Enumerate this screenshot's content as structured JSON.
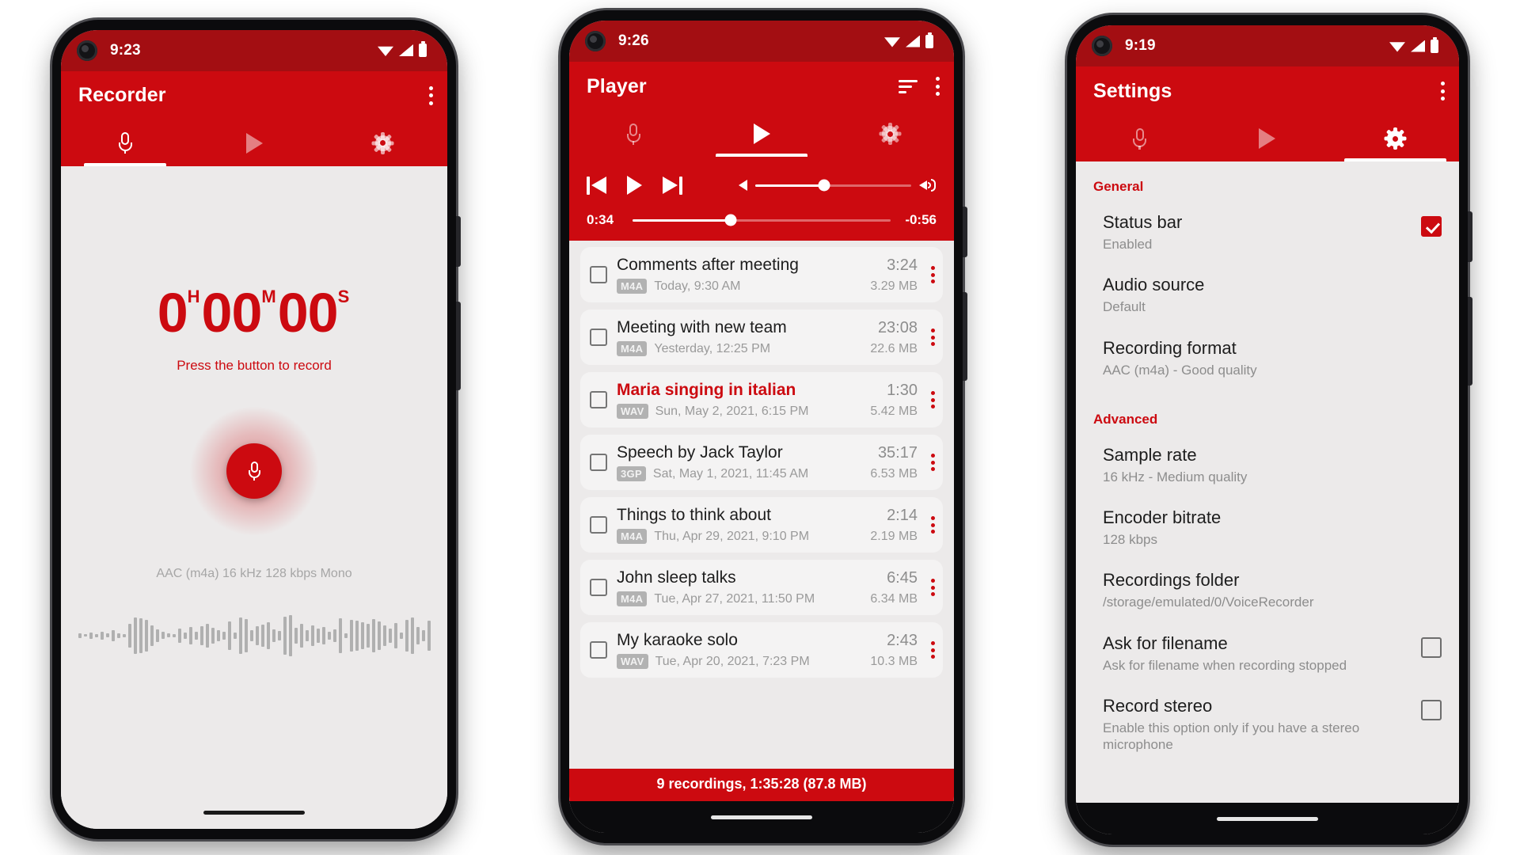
{
  "colors": {
    "brand": "#cc0a10",
    "status_bar": "#a30e12",
    "screen_bg": "#eceaea",
    "card_bg": "#f4f3f3",
    "muted_text": "#9a9a9a"
  },
  "phone_recorder": {
    "status": {
      "time": "9:23",
      "wifi": "wifi-icon",
      "signal": "signal-icon",
      "battery": "battery-icon"
    },
    "appbar": {
      "title": "Recorder",
      "overflow": "overflow-menu-icon"
    },
    "tabs": [
      {
        "id": "record",
        "icon": "microphone-icon",
        "active": false
      },
      {
        "id": "player",
        "icon": "play-icon",
        "active": false
      },
      {
        "id": "settings",
        "icon": "gear-icon",
        "active": false
      }
    ],
    "active_tab": "record",
    "timer": {
      "hours": "0",
      "hours_unit": "H",
      "minutes": "00",
      "minutes_unit": "M",
      "seconds": "00",
      "seconds_unit": "S"
    },
    "hint": "Press the button to record",
    "record_button": "microphone-icon",
    "format_line": "AAC (m4a) 16 kHz 128 kbps Mono"
  },
  "phone_player": {
    "status": {
      "time": "9:26"
    },
    "appbar": {
      "title": "Player",
      "sort": "sort-icon",
      "overflow": "overflow-menu-icon"
    },
    "tabs": [
      {
        "id": "record",
        "icon": "microphone-icon"
      },
      {
        "id": "player",
        "icon": "play-icon"
      },
      {
        "id": "settings",
        "icon": "gear-icon"
      }
    ],
    "active_tab": "player",
    "controls": {
      "previous": "previous-track-icon",
      "play": "play-icon",
      "next": "next-track-icon",
      "volume_min": "volume-low-icon",
      "volume_max": "volume-high-icon",
      "volume_percent": 44
    },
    "seek": {
      "elapsed": "0:34",
      "remaining": "-0:56",
      "progress_percent": 38
    },
    "recordings": [
      {
        "title": "Comments after meeting",
        "duration": "3:24",
        "format": "M4A",
        "date": "Today, 9:30 AM",
        "size": "3.29 MB",
        "active": false
      },
      {
        "title": "Meeting with new team",
        "duration": "23:08",
        "format": "M4A",
        "date": "Yesterday, 12:25 PM",
        "size": "22.6 MB",
        "active": false
      },
      {
        "title": "Maria singing in italian",
        "duration": "1:30",
        "format": "WAV",
        "date": "Sun, May 2, 2021, 6:15 PM",
        "size": "5.42 MB",
        "active": true
      },
      {
        "title": "Speech by Jack Taylor",
        "duration": "35:17",
        "format": "3GP",
        "date": "Sat, May 1, 2021, 11:45 AM",
        "size": "6.53 MB",
        "active": false
      },
      {
        "title": "Things to think about",
        "duration": "2:14",
        "format": "M4A",
        "date": "Thu, Apr 29, 2021, 9:10 PM",
        "size": "2.19 MB",
        "active": false
      },
      {
        "title": "John sleep talks",
        "duration": "6:45",
        "format": "M4A",
        "date": "Tue, Apr 27, 2021, 11:50 PM",
        "size": "6.34 MB",
        "active": false
      },
      {
        "title": "My karaoke solo",
        "duration": "2:43",
        "format": "WAV",
        "date": "Tue, Apr 20, 2021, 7:23 PM",
        "size": "10.3 MB",
        "active": false
      }
    ],
    "footer": "9 recordings, 1:35:28 (87.8 MB)"
  },
  "phone_settings": {
    "status": {
      "time": "9:19"
    },
    "appbar": {
      "title": "Settings",
      "overflow": "overflow-menu-icon"
    },
    "tabs": [
      {
        "id": "record",
        "icon": "microphone-icon"
      },
      {
        "id": "player",
        "icon": "play-icon"
      },
      {
        "id": "settings",
        "icon": "gear-icon"
      }
    ],
    "active_tab": "settings",
    "sections": [
      {
        "heading": "General",
        "rows": [
          {
            "title": "Status bar",
            "subtitle": "Enabled",
            "checkbox": "checked"
          },
          {
            "title": "Audio source",
            "subtitle": "Default",
            "checkbox": "none"
          },
          {
            "title": "Recording format",
            "subtitle": "AAC (m4a) - Good quality",
            "checkbox": "none"
          }
        ]
      },
      {
        "heading": "Advanced",
        "rows": [
          {
            "title": "Sample rate",
            "subtitle": "16 kHz - Medium quality",
            "checkbox": "none"
          },
          {
            "title": "Encoder bitrate",
            "subtitle": "128 kbps",
            "checkbox": "none"
          },
          {
            "title": "Recordings folder",
            "subtitle": "/storage/emulated/0/VoiceRecorder",
            "checkbox": "none"
          },
          {
            "title": "Ask for filename",
            "subtitle": "Ask for filename when recording stopped",
            "checkbox": "unchecked"
          },
          {
            "title": "Record stereo",
            "subtitle": "Enable this option only if you have a stereo microphone",
            "checkbox": "unchecked"
          }
        ]
      }
    ]
  },
  "waveform": [
    6,
    3,
    8,
    4,
    10,
    5,
    14,
    6,
    4,
    30,
    46,
    44,
    40,
    26,
    16,
    9,
    5,
    4,
    18,
    8,
    22,
    10,
    24,
    30,
    20,
    14,
    10,
    36,
    8,
    46,
    42,
    14,
    24,
    28,
    34,
    16,
    12,
    48,
    52,
    20,
    30,
    14,
    26,
    18,
    22,
    10,
    16,
    44,
    6,
    40,
    38,
    34,
    30,
    42,
    36,
    26,
    18,
    32,
    8,
    40,
    46,
    22,
    14,
    38
  ]
}
